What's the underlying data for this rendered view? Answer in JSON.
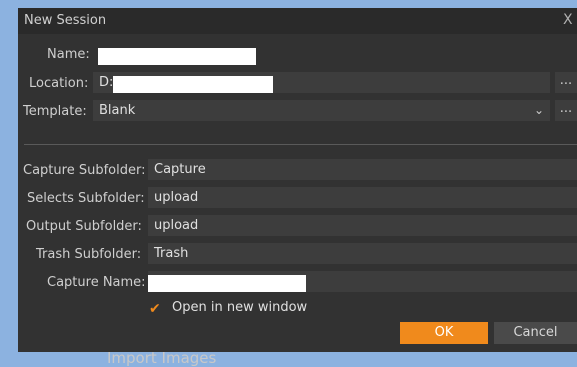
{
  "backdrop": {
    "partial_text": "Import Images"
  },
  "dialog": {
    "title": "New Session",
    "close_glyph": "X",
    "name_label": "Name:",
    "location_label": "Location:",
    "location_value": "D:\\",
    "browse_glyph": "...",
    "template_label": "Template:",
    "template_value": "Blank",
    "capture_subfolder_label": "Capture Subfolder:",
    "capture_subfolder_value": "Capture",
    "selects_subfolder_label": "Selects Subfolder:",
    "selects_subfolder_value": "upload",
    "output_subfolder_label": "Output Subfolder:",
    "output_subfolder_value": "upload",
    "trash_subfolder_label": "Trash Subfolder:",
    "trash_subfolder_value": "Trash",
    "capture_name_label": "Capture Name:",
    "open_new_window_label": "Open in new window",
    "open_new_window_checked": true,
    "ok_label": "OK",
    "cancel_label": "Cancel",
    "accent_color": "#f08a1c"
  }
}
